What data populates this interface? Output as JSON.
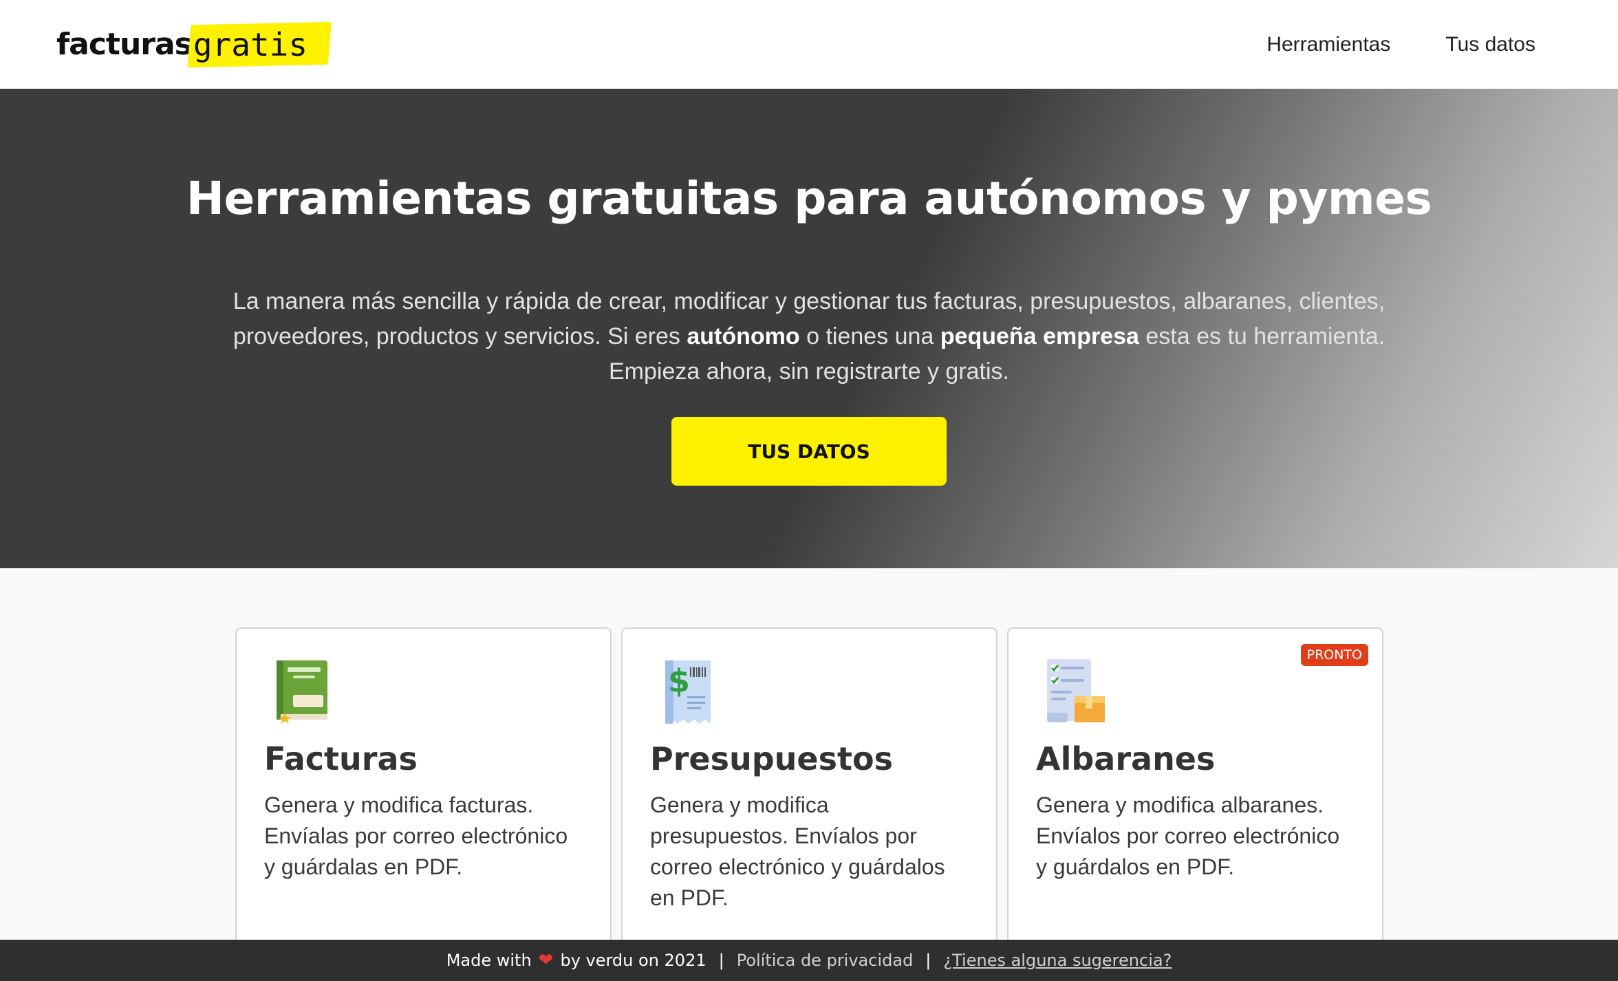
{
  "header": {
    "logo_part1": "facturas",
    "logo_part2": "gratis",
    "nav": [
      {
        "label": "Herramientas"
      },
      {
        "label": "Tus datos"
      }
    ]
  },
  "hero": {
    "title": "Herramientas gratuitas para autónomos y pymes",
    "desc_part1": "La manera más sencilla y rápida de crear, modificar y gestionar tus facturas, presupuestos, albaranes, clientes, proveedores, productos y servicios. Si eres ",
    "desc_bold1": "autónomo",
    "desc_part2": " o tienes una ",
    "desc_bold2": "pequeña empresa",
    "desc_part3": " esta es tu herramienta. Empieza ahora, sin registrarte y gratis.",
    "cta_label": "TUS DATOS"
  },
  "cards": [
    {
      "icon": "invoice-book-icon",
      "title": "Facturas",
      "description": "Genera y modifica facturas. Envíalas por correo electrónico y guárdalas en PDF."
    },
    {
      "icon": "budget-receipt-icon",
      "title": "Presupuestos",
      "description": "Genera y modifica presupuestos. Envíalos por correo electrónico y guárdalos en PDF."
    },
    {
      "icon": "delivery-note-icon",
      "title": "Albaranes",
      "description": "Genera y modifica albaranes. Envíalos por correo electrónico y guárdalos en PDF.",
      "badge": "PRONTO"
    }
  ],
  "footer": {
    "made_with": "Made with",
    "by": "by verdu on 2021",
    "separator": "|",
    "privacy": "Política de privacidad",
    "suggestion": "¿Tienes alguna sugerencia?"
  },
  "colors": {
    "accent_yellow": "#fff200",
    "badge_red": "#e03e1a",
    "hero_dark": "#3c3c3c",
    "footer_bg": "#2f2f2f"
  }
}
